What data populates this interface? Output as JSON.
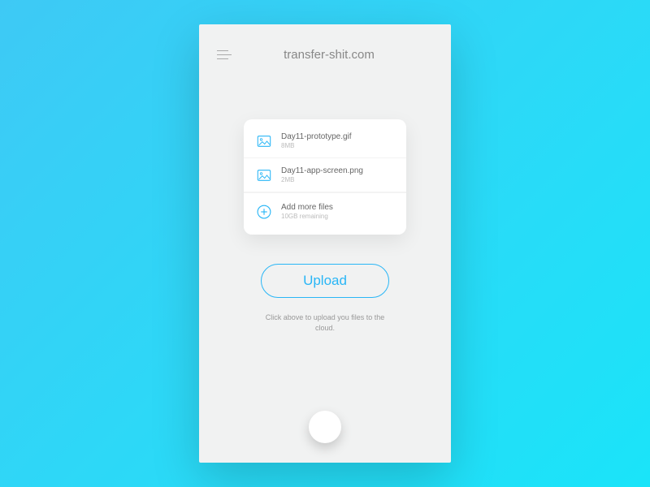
{
  "header": {
    "title": "transfer-shit.com"
  },
  "files": [
    {
      "name": "Day11-prototype.gif",
      "size": "8MB"
    },
    {
      "name": "Day11-app-screen.png",
      "size": "2MB"
    }
  ],
  "addMore": {
    "label": "Add more files",
    "remaining": "10GB remaining"
  },
  "uploadButton": "Upload",
  "helpText": "Click above to upload you files to the cloud.",
  "colors": {
    "accent": "#29b6f6"
  }
}
